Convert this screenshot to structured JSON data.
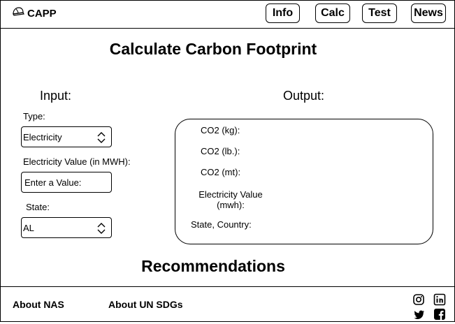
{
  "header": {
    "brand": "CAPP",
    "nav": [
      "Info",
      "Calc",
      "Test",
      "News"
    ]
  },
  "main": {
    "title": "Calculate Carbon Footprint",
    "input_heading": "Input:",
    "output_heading": "Output:",
    "type_label": "Type:",
    "type_value": "Electricity",
    "electricity_label": "Electricity Value (in MWH):",
    "electricity_placeholder": "Enter a Value:",
    "state_label": "State:",
    "state_value": "AL",
    "outputs": {
      "co2_kg": "CO2 (kg):",
      "co2_lb": "CO2 (lb.):",
      "co2_mt": "CO2 (mt):",
      "electricity_line1": "Electricity Value",
      "electricity_line2": "(mwh):",
      "state_country": "State, Country:"
    },
    "recommendations": "Recommendations"
  },
  "footer": {
    "about_nas": "About NAS",
    "about_un": "About  UN SDGs",
    "social_icons": [
      "instagram-icon",
      "linkedin-icon",
      "twitter-icon",
      "facebook-icon"
    ]
  }
}
